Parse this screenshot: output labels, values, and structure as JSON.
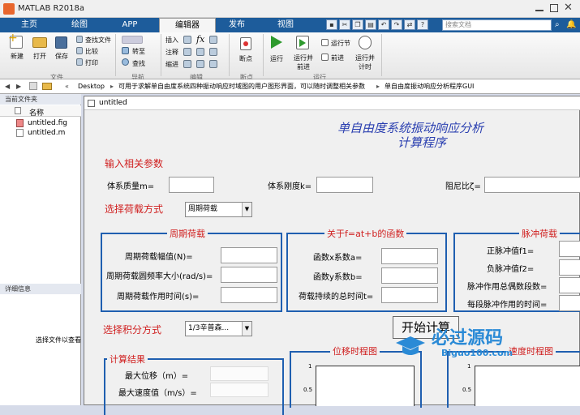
{
  "window": {
    "title": "MATLAB R2018a"
  },
  "tabs": [
    "主页",
    "绘图",
    "APP",
    "编辑器",
    "发布",
    "视图"
  ],
  "search": {
    "placeholder": "搜索文档"
  },
  "ribbon": {
    "file": [
      "新建",
      "打开",
      "保存"
    ],
    "file_small": [
      "查找文件",
      "比较",
      "打印"
    ],
    "nav": [
      "转至",
      "查找"
    ],
    "edit": [
      "插入",
      "注释",
      "缩进"
    ],
    "breakpoint": "断点",
    "run": [
      "运行",
      "运行并前进",
      "运行节",
      "前进",
      "运行并计时"
    ],
    "groups": [
      "文件",
      "导航",
      "编辑",
      "断点",
      "运行"
    ]
  },
  "address": {
    "sep": "«",
    "items": [
      "Desktop",
      "可用于求解单自由度系统四种振动响应时域图的用户图形界面，可以随时调整相关参数",
      "单自由度振动响应分析程序GUI"
    ]
  },
  "left_panel": {
    "current_folder": "当前文件夹",
    "col_name": "名称",
    "files": [
      "untitled.fig",
      "untitled.m"
    ],
    "details": "详细信息",
    "details_hint": "选择文件以查看"
  },
  "figure": {
    "window_title": "untitled",
    "title_line1": "单自由度系统振动响应分析",
    "title_line2": "计算程序",
    "input_params": "输入相关参数",
    "mass": "体系质量m=",
    "stiffness": "体系刚度k=",
    "damping": "阻尼比ζ=",
    "load_type_label": "选择荷载方式",
    "load_type_value": "周期荷载",
    "periodic": {
      "title": "周期荷载",
      "amp": "周期荷载幅值(N)=",
      "freq": "周期荷载圆频率大小(rad/s)=",
      "time": "周期荷载作用时间(s)="
    },
    "linear": {
      "title": "关于f=at+b的函数",
      "a": "函数x系数a=",
      "b": "函数y系数b=",
      "time": "荷载持续的总时间t="
    },
    "pulse": {
      "title": "脉冲荷载",
      "f1": "正脉冲值f1=",
      "f2": "负脉冲值f2=",
      "count": "脉冲作用总偶数段数=",
      "time": "每段脉冲作用的时间="
    },
    "integration_label": "选择积分方式",
    "integration_value": "1/3辛普森...",
    "start_button": "开始计算",
    "results": {
      "title": "计算结果",
      "max_disp": "最大位移（m）=",
      "max_vel": "最大速度值（m/s）="
    },
    "plot1": {
      "title": "位移时程图",
      "ticks": [
        "1",
        "0.5"
      ]
    },
    "plot2": {
      "title": "速度时程图",
      "ticks": [
        "1",
        "0.5"
      ]
    }
  },
  "watermark": {
    "main": "必过源码",
    "url": "Biguo100.com"
  }
}
